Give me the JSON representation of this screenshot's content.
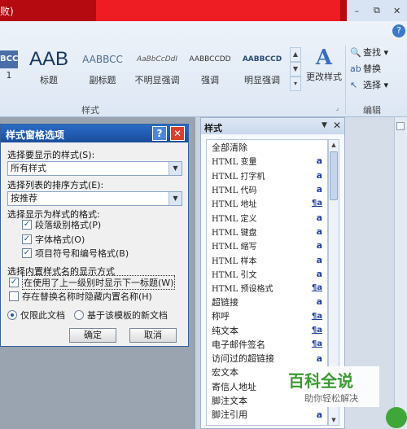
{
  "window": {
    "title_fragment": "败)",
    "controls": [
      "–",
      "⧉",
      "✕"
    ],
    "help_glyph": "?"
  },
  "ribbon": {
    "gallery": [
      {
        "sample": "BCCI",
        "label": "1"
      },
      {
        "sample": "AAB",
        "label": "标题"
      },
      {
        "sample": "AABBCC",
        "label": "副标题"
      },
      {
        "sample": "AaBbCcDdI",
        "label": "不明显强调"
      },
      {
        "sample": "AABBCCDD",
        "label": "强调"
      },
      {
        "sample": "AABBCCD",
        "label": "明显强调"
      }
    ],
    "change_styles_icon": "A",
    "change_styles_label": "更改样式",
    "styles_group_label": "样式",
    "edit_items": [
      {
        "icon": "🔍",
        "label": "查找 ▾"
      },
      {
        "icon": "ab",
        "label": "替换"
      },
      {
        "icon": "↖",
        "label": "选择 ▾"
      }
    ],
    "edit_group_label": "编辑",
    "launcher_glyph": "⌟"
  },
  "dialog": {
    "title": "样式窗格选项",
    "help": "?",
    "close": "✕",
    "show_label": "选择要显示的样式(S):",
    "show_value": "所有样式",
    "sort_label": "选择列表的排序方式(E):",
    "sort_value": "按推荐",
    "format_label": "选择显示为样式的格式:",
    "format_options": [
      {
        "label": "段落级别格式(P)",
        "checked": true
      },
      {
        "label": "字体格式(O)",
        "checked": true
      },
      {
        "label": "项目符号和编号格式(B)",
        "checked": true
      }
    ],
    "builtin_label": "选择内置样式名的显示方式",
    "builtin_options": [
      {
        "label": "在使用了上一级别时显示下一标题(W)",
        "checked": true
      },
      {
        "label": "存在替换名称时隐藏内置名称(H)",
        "checked": false
      }
    ],
    "scope_options": [
      {
        "label": "仅限此文档",
        "selected": true
      },
      {
        "label": "基于该模板的新文档",
        "selected": false
      }
    ],
    "ok_label": "确定",
    "cancel_label": "取消"
  },
  "styles_pane": {
    "title": "样式",
    "menu_glyph": "▼",
    "close_glyph": "✕",
    "items": [
      {
        "name": "全部清除",
        "icon": "",
        "mono": false
      },
      {
        "name": "HTML 变量",
        "icon": "a",
        "mono": true
      },
      {
        "name": "HTML 打字机",
        "icon": "a",
        "mono": true
      },
      {
        "name": "HTML 代码",
        "icon": "a",
        "mono": true
      },
      {
        "name": "HTML 地址",
        "icon": "¶a",
        "mono": true
      },
      {
        "name": "HTML 定义",
        "icon": "a",
        "mono": true
      },
      {
        "name": "HTML 键盘",
        "icon": "a",
        "mono": true
      },
      {
        "name": "HTML 缩写",
        "icon": "a",
        "mono": true
      },
      {
        "name": "HTML 样本",
        "icon": "a",
        "mono": true
      },
      {
        "name": "HTML 引文",
        "icon": "a",
        "mono": true
      },
      {
        "name": "HTML 预设格式",
        "icon": "¶a",
        "mono": true
      },
      {
        "name": "超链接",
        "icon": "a",
        "mono": false
      },
      {
        "name": "称呼",
        "icon": "¶a",
        "mono": false
      },
      {
        "name": "纯文本",
        "icon": "¶a",
        "mono": false
      },
      {
        "name": "电子邮件签名",
        "icon": "¶a",
        "mono": false
      },
      {
        "name": "访问过的超链接",
        "icon": "a",
        "mono": false
      },
      {
        "name": "宏文本",
        "icon": "",
        "mono": false
      },
      {
        "name": "寄信人地址",
        "icon": "",
        "mono": false
      },
      {
        "name": "脚注文本",
        "icon": "",
        "mono": false
      },
      {
        "name": "脚注引用",
        "icon": "a",
        "mono": false
      }
    ]
  },
  "watermark": {
    "logo": "百科全说",
    "subtitle": "助你轻松解决"
  }
}
